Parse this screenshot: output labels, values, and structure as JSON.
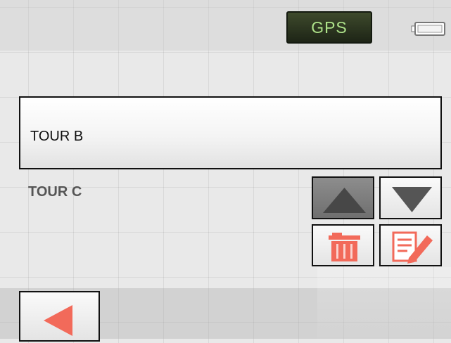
{
  "status_bar": {
    "gps_label": "GPS",
    "battery_icon": "battery-icon"
  },
  "tours": {
    "selected": "TOUR B",
    "items": [
      "TOUR C"
    ]
  },
  "controls": {
    "up_icon": "arrow-up-icon",
    "down_icon": "arrow-down-icon",
    "delete_icon": "trash-icon",
    "edit_icon": "edit-icon",
    "back_icon": "back-arrow-icon"
  },
  "colors": {
    "gps_text": "#aee38a",
    "icon_accent": "#f26a5a"
  }
}
